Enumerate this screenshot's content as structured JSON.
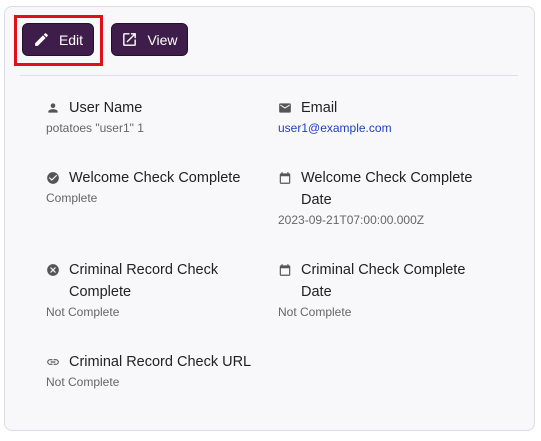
{
  "actions": {
    "edit_label": "Edit",
    "view_label": "View"
  },
  "fields": {
    "user_name": {
      "label": "User Name",
      "value": "potatoes \"user1\" 1",
      "icon": "person-icon"
    },
    "email": {
      "label": "Email",
      "value": "user1@example.com",
      "icon": "mail-icon"
    },
    "welcome_check": {
      "label": "Welcome Check Complete",
      "value": "Complete",
      "icon": "check-circle-icon"
    },
    "welcome_check_date": {
      "label": "Welcome Check Complete Date",
      "value": "2023-09-21T07:00:00.000Z",
      "icon": "calendar-icon"
    },
    "criminal_check": {
      "label": "Criminal Record Check Complete",
      "value": "Not Complete",
      "icon": "x-circle-icon"
    },
    "criminal_check_date": {
      "label": "Criminal Check Complete Date",
      "value": "Not Complete",
      "icon": "calendar-icon"
    },
    "criminal_check_url": {
      "label": "Criminal Record Check URL",
      "value": "Not Complete",
      "icon": "link-icon"
    }
  },
  "colors": {
    "button_bg": "#3f1d4a",
    "highlight": "#e0101a",
    "link": "#1f3fbf"
  }
}
